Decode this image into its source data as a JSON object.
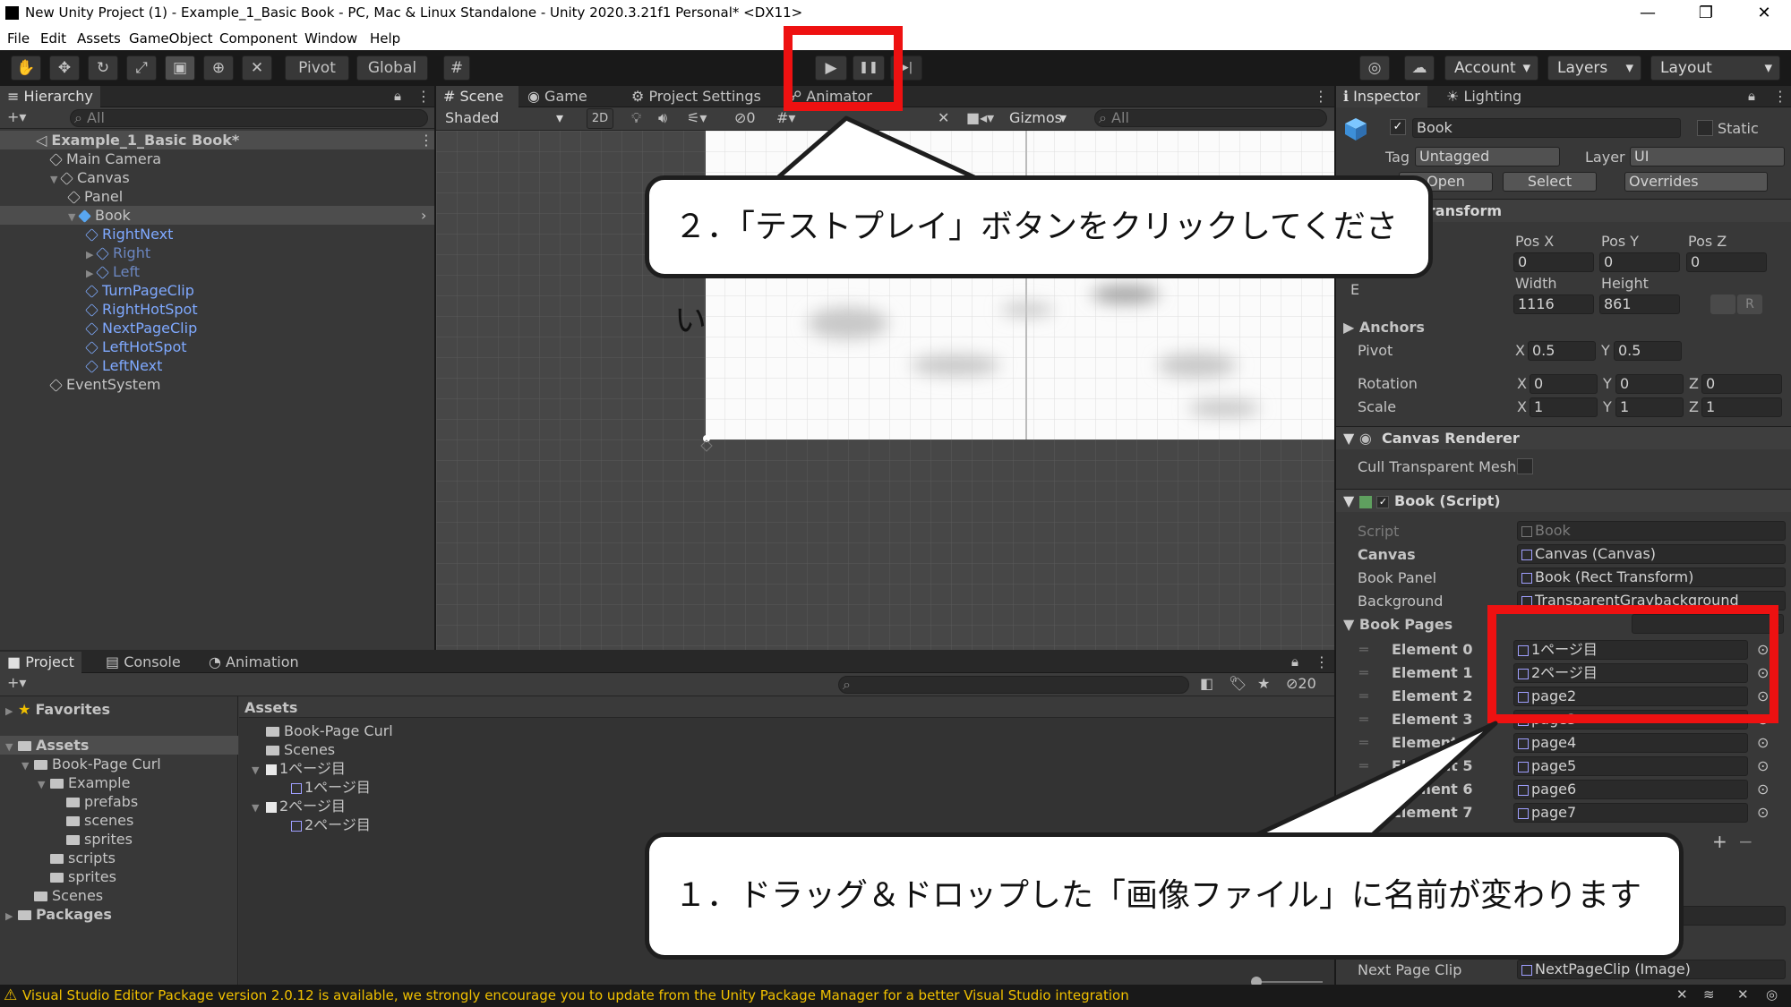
{
  "window": {
    "title": "New Unity Project (1) - Example_1_Basic Book - PC, Mac & Linux Standalone - Unity 2020.3.21f1 Personal* <DX11>",
    "minimize": "—",
    "restore": "❐",
    "close": "✕"
  },
  "menu": [
    "File",
    "Edit",
    "Assets",
    "GameObject",
    "Component",
    "Window",
    "Help"
  ],
  "toolbar": {
    "pivot": "Pivot",
    "global": "Global",
    "play": "▶",
    "pause": "❚❚",
    "step": "▶|",
    "account": "Account",
    "layers": "Layers",
    "layout": "Layout",
    "tools": [
      "hand-icon",
      "move-icon",
      "rotate-icon",
      "scale-icon",
      "rect-icon",
      "transform-icon",
      "custom-tool-icon"
    ]
  },
  "hierarchy": {
    "tab": "Hierarchy",
    "search_placeholder": "All",
    "add": "+▾",
    "rows": [
      {
        "label": "Example_1_Basic Book*",
        "depth": 0,
        "style": "scene"
      },
      {
        "label": "Main Camera",
        "depth": 1,
        "style": "normal"
      },
      {
        "label": "Canvas",
        "depth": 1,
        "style": "normal",
        "arrow": "▼"
      },
      {
        "label": "Panel",
        "depth": 2,
        "style": "normal"
      },
      {
        "label": "Book",
        "depth": 2,
        "style": "selected",
        "arrow": "▼"
      },
      {
        "label": "RightNext",
        "depth": 3,
        "style": "blue"
      },
      {
        "label": "Right",
        "depth": 3,
        "style": "dim",
        "arrow": "▶"
      },
      {
        "label": "Left",
        "depth": 3,
        "style": "dim",
        "arrow": "▶"
      },
      {
        "label": "TurnPageClip",
        "depth": 3,
        "style": "blue"
      },
      {
        "label": "RightHotSpot",
        "depth": 3,
        "style": "blue"
      },
      {
        "label": "NextPageClip",
        "depth": 3,
        "style": "blue"
      },
      {
        "label": "LeftHotSpot",
        "depth": 3,
        "style": "blue"
      },
      {
        "label": "LeftNext",
        "depth": 3,
        "style": "blue"
      },
      {
        "label": "EventSystem",
        "depth": 1,
        "style": "normal"
      }
    ]
  },
  "scene": {
    "tabs": [
      "Scene",
      "Game",
      "Project Settings",
      "Animator"
    ],
    "shaded": "Shaded",
    "mode2d": "2D",
    "gizmos": "Gizmos",
    "search_placeholder": "All",
    "hidden_count": "0"
  },
  "inspector": {
    "tabs": [
      "Inspector",
      "Lighting"
    ],
    "object_name": "Book",
    "static": "Static",
    "tag_label": "Tag",
    "tag_value": "Untagged",
    "layer_label": "Layer",
    "layer_value": "UI",
    "prefab_open": "Open",
    "prefab_select": "Select",
    "prefab_overrides": "Overrides",
    "rect_transform": {
      "header": "Rect Transform",
      "posx_label": "Pos X",
      "posy_label": "Pos Y",
      "posz_label": "Pos Z",
      "posx": "0",
      "posy": "0",
      "posz": "0",
      "width_label": "Width",
      "height_label": "Height",
      "width": "1116",
      "height": "861",
      "anchors": "Anchors",
      "pivot": "Pivot",
      "pivot_x": "0.5",
      "pivot_y": "0.5",
      "rotation": "Rotation",
      "rot_x": "0",
      "rot_y": "0",
      "rot_z": "0",
      "scale": "Scale",
      "scale_x": "1",
      "scale_y": "1",
      "scale_z": "1",
      "axis_x": "X",
      "axis_y": "Y",
      "axis_z": "Z",
      "r_btn": "R",
      "edge": "E"
    },
    "canvas_renderer": {
      "header": "Canvas Renderer",
      "cull_label": "Cull Transparent Mesh"
    },
    "book_script": {
      "header": "Book (Script)",
      "script_label": "Script",
      "script_value": "Book",
      "canvas_label": "Canvas",
      "canvas_value": "Canvas (Canvas)",
      "panel_label": "Book Panel",
      "panel_value": "Book (Rect Transform)",
      "background_label": "Background",
      "background_value": "TransparentGraybackground",
      "pages_label": "Book Pages",
      "pages_count": "8",
      "elements": [
        {
          "label": "Element 0",
          "value": "1ページ目"
        },
        {
          "label": "Element 1",
          "value": "2ページ目"
        },
        {
          "label": "Element 2",
          "value": "page2"
        },
        {
          "label": "Element 3",
          "value": "page3"
        },
        {
          "label": "Element 4",
          "value": "page4"
        },
        {
          "label": "Element 5",
          "value": "page5"
        },
        {
          "label": "Element 6",
          "value": "page6"
        },
        {
          "label": "Element 7",
          "value": "page7"
        }
      ],
      "add": "+",
      "remove": "−",
      "next_clip_label": "Next Page Clip",
      "next_clip_value": "NextPageClip (Image)"
    }
  },
  "project": {
    "tabs": [
      "Project",
      "Console",
      "Animation"
    ],
    "search_placeholder": "",
    "hidden_count": "20",
    "tree": [
      {
        "label": "Favorites",
        "depth": 0,
        "arrow": "▶",
        "icon": "star"
      },
      {
        "label": "Assets",
        "depth": 0,
        "arrow": "▼",
        "icon": "folder",
        "bold": true
      },
      {
        "label": "Book-Page Curl",
        "depth": 1,
        "arrow": "▼",
        "icon": "folder"
      },
      {
        "label": "Example",
        "depth": 2,
        "arrow": "▼",
        "icon": "folder"
      },
      {
        "label": "prefabs",
        "depth": 3,
        "icon": "folder"
      },
      {
        "label": "scenes",
        "depth": 3,
        "icon": "folder"
      },
      {
        "label": "sprites",
        "depth": 3,
        "icon": "folder"
      },
      {
        "label": "scripts",
        "depth": 2,
        "icon": "folder"
      },
      {
        "label": "sprites",
        "depth": 2,
        "icon": "folder"
      },
      {
        "label": "Scenes",
        "depth": 1,
        "icon": "folder"
      },
      {
        "label": "Packages",
        "depth": 0,
        "arrow": "▶",
        "icon": "folder",
        "bold": true
      }
    ],
    "assets_header": "Assets",
    "assets": [
      {
        "label": "Book-Page Curl",
        "depth": 0,
        "icon": "folder"
      },
      {
        "label": "Scenes",
        "depth": 0,
        "icon": "folder"
      },
      {
        "label": "1ページ目",
        "depth": 0,
        "icon": "sprite",
        "arrow": "▼"
      },
      {
        "label": "1ページ目",
        "depth": 1,
        "icon": "image"
      },
      {
        "label": "2ページ目",
        "depth": 0,
        "icon": "sprite",
        "arrow": "▼"
      },
      {
        "label": "2ページ目",
        "depth": 1,
        "icon": "image"
      }
    ]
  },
  "status": {
    "message": "Visual Studio Editor Package version 2.0.12 is available, we strongly encourage you to update from the Unity Package Manager for a better Visual Studio integration",
    "warning_icon": "⚠"
  },
  "callouts": {
    "step2": "２．「テストプレイ」ボタンをクリックしてください",
    "step1": "１．ドラッグ＆ドロップした「画像ファイル」に名前が変わります"
  },
  "colors": {
    "highlight_red": "#ee1111",
    "play_blue": "#3c8bdc",
    "warning": "#f0c000"
  }
}
